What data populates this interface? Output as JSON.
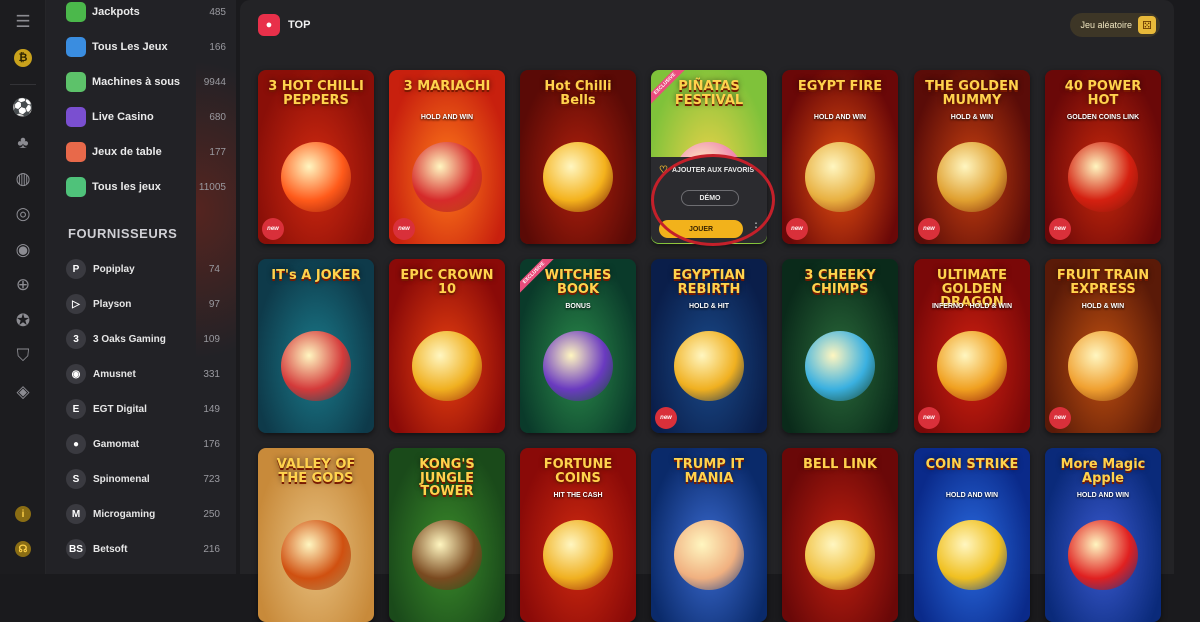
{
  "rail": {
    "icons": [
      "menu-icon",
      "coin-icon",
      "soccer-icon",
      "card-suit-icon",
      "basketball-icon",
      "signal-icon",
      "target-icon",
      "crosshair-icon",
      "star-badge-icon",
      "shield-icon",
      "cash-icon",
      "info-icon",
      "support-icon"
    ]
  },
  "sidebar": {
    "categories": [
      {
        "label": "Jackpots",
        "count": "485",
        "color": "#4bb84b"
      },
      {
        "label": "Tous Les Jeux",
        "count": "166",
        "color": "#3a8de0"
      },
      {
        "label": "Machines à sous",
        "count": "9944",
        "color": "#5dc26a"
      },
      {
        "label": "Live Casino",
        "count": "680",
        "color": "#7a4fd0"
      },
      {
        "label": "Jeux de table",
        "count": "177",
        "color": "#e8694a"
      },
      {
        "label": "Tous les jeux",
        "count": "11005",
        "color": "#4fc27a"
      }
    ],
    "providers_title": "FOURNISSEURS",
    "providers": [
      {
        "label": "Popiplay",
        "count": "74",
        "glyph": "P"
      },
      {
        "label": "Playson",
        "count": "97",
        "glyph": "▷"
      },
      {
        "label": "3 Oaks Gaming",
        "count": "109",
        "glyph": "3"
      },
      {
        "label": "Amusnet",
        "count": "331",
        "glyph": "◉"
      },
      {
        "label": "EGT Digital",
        "count": "149",
        "glyph": "E"
      },
      {
        "label": "Gamomat",
        "count": "176",
        "glyph": "●"
      },
      {
        "label": "Spinomenal",
        "count": "723",
        "glyph": "S"
      },
      {
        "label": "Microgaming",
        "count": "250",
        "glyph": "M"
      },
      {
        "label": "Betsoft",
        "count": "216",
        "glyph": "BS"
      }
    ]
  },
  "main": {
    "title": "TOP",
    "random_label": "Jeu aléatoire"
  },
  "hover": {
    "fav_label": "AJOUTER AUX FAVORIS",
    "demo_label": "DÉMO",
    "play_label": "JOUER"
  },
  "games": [
    {
      "title": "3 HOT CHILLI PEPPERS",
      "sub": "",
      "bg": "#8a0f08",
      "bg2": "#d22a10",
      "art": "#ff5a1a",
      "new": true,
      "excl": false
    },
    {
      "title": "3 MARIACHI",
      "sub": "HOLD AND WIN",
      "bg": "#c8200e",
      "bg2": "#ff7a1a",
      "art": "#d62a2a",
      "new": true,
      "excl": false
    },
    {
      "title": "Hot Chilli Bells",
      "sub": "",
      "bg": "#5a0a06",
      "bg2": "#b0200c",
      "art": "#f4b21c",
      "new": false,
      "excl": false
    },
    {
      "title": "PIÑATAS FESTIVAL",
      "sub": "",
      "bg": "#7fc23a",
      "bg2": "#f0d34a",
      "art": "#f08ab0",
      "new": false,
      "excl": true
    },
    {
      "title": "EGYPT FIRE",
      "sub": "HOLD AND WIN",
      "bg": "#6a0808",
      "bg2": "#e85010",
      "art": "#e8b040",
      "new": true,
      "excl": false
    },
    {
      "title": "THE GOLDEN MUMMY",
      "sub": "HOLD & WIN",
      "bg": "#5a0c08",
      "bg2": "#c84010",
      "art": "#e0a030",
      "new": true,
      "excl": false
    },
    {
      "title": "40 POWER HOT",
      "sub": "GOLDEN COINS LINK",
      "bg": "#6a0808",
      "bg2": "#c8280c",
      "art": "#d42010",
      "new": true,
      "excl": false
    },
    {
      "title": "IT's A JOKER",
      "sub": "",
      "bg": "#0e3a4a",
      "bg2": "#1a7a8a",
      "art": "#d43a3a",
      "new": false,
      "excl": false
    },
    {
      "title": "EPIC CROWN 10",
      "sub": "",
      "bg": "#8a0a08",
      "bg2": "#e84010",
      "art": "#f0b020",
      "new": false,
      "excl": false
    },
    {
      "title": "WITCHES BOOK",
      "sub": "BONUS",
      "bg": "#0a3a2a",
      "bg2": "#2a8a4a",
      "art": "#6a3ac0",
      "new": false,
      "excl": true
    },
    {
      "title": "EGYPTIAN REBIRTH",
      "sub": "HOLD & HIT",
      "bg": "#0a1e4a",
      "bg2": "#1a4a8a",
      "art": "#f0b020",
      "new": true,
      "excl": false
    },
    {
      "title": "3 CHEEKY CHIMPS",
      "sub": "",
      "bg": "#0a2a1a",
      "bg2": "#2a6a3a",
      "art": "#3ab0e0",
      "new": false,
      "excl": false
    },
    {
      "title": "ULTIMATE GOLDEN DRAGON",
      "sub": "INFERNO · HOLD & WIN",
      "bg": "#7a0808",
      "bg2": "#d02010",
      "art": "#f0a020",
      "new": true,
      "excl": false
    },
    {
      "title": "FRUIT TRAIN EXPRESS",
      "sub": "HOLD & WIN",
      "bg": "#5a1a08",
      "bg2": "#c05010",
      "art": "#f0a030",
      "new": true,
      "excl": false
    },
    {
      "title": "VALLEY OF THE GODS",
      "sub": "",
      "bg": "#c88a3a",
      "bg2": "#e8c080",
      "art": "#d05010",
      "new": false,
      "excl": false
    },
    {
      "title": "KONG'S JUNGLE TOWER",
      "sub": "",
      "bg": "#1a4a1a",
      "bg2": "#3a8a2a",
      "art": "#7a4a20",
      "new": false,
      "excl": false
    },
    {
      "title": "FORTUNE COINS",
      "sub": "HIT THE CASH",
      "bg": "#8a0a08",
      "bg2": "#d02a10",
      "art": "#f0b020",
      "new": false,
      "excl": false
    },
    {
      "title": "TRUMP IT MANIA",
      "sub": "",
      "bg": "#0a2a6a",
      "bg2": "#3a6ad0",
      "art": "#f0b080",
      "new": false,
      "excl": false
    },
    {
      "title": "BELL LINK",
      "sub": "",
      "bg": "#6a0808",
      "bg2": "#c02010",
      "art": "#f0c040",
      "new": false,
      "excl": false
    },
    {
      "title": "COIN STRIKE",
      "sub": "HOLD AND WIN",
      "bg": "#0a2a8a",
      "bg2": "#2a6ae0",
      "art": "#f0c020",
      "new": false,
      "excl": false
    },
    {
      "title": "More Magic Apple",
      "sub": "HOLD AND WIN",
      "bg": "#0a2a7a",
      "bg2": "#3a5ad0",
      "art": "#e02020",
      "new": false,
      "excl": false
    }
  ]
}
